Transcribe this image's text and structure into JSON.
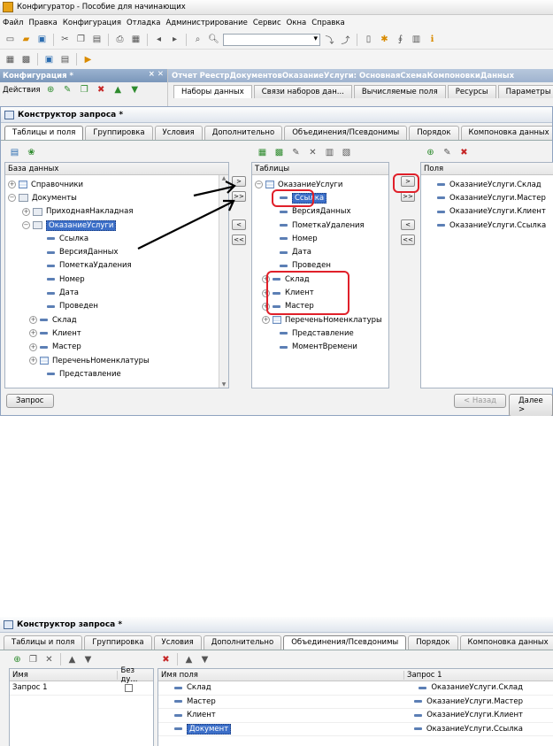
{
  "window": {
    "title": "Конфигуратор - Пособие для начинающих"
  },
  "menu": [
    "Файл",
    "Правка",
    "Конфигурация",
    "Отладка",
    "Администрирование",
    "Сервис",
    "Окна",
    "Справка"
  ],
  "config_panel": {
    "title": "Конфигурация *",
    "actions_label": "Действия"
  },
  "report_window": {
    "title": "Отчет РеестрДокументовОказаниеУслуги: ОсновнаяСхемаКомпоновкиДанных",
    "tabs": [
      "Наборы данных",
      "Связи наборов дан...",
      "Вычисляемые поля",
      "Ресурсы",
      "Параметры",
      "М"
    ]
  },
  "query_designer": {
    "title": "Конструктор запроса *",
    "tabs": [
      "Таблицы и поля",
      "Группировка",
      "Условия",
      "Дополнительно",
      "Объединения/Псевдонимы",
      "Порядок",
      "Компоновка данных",
      "Хар"
    ],
    "database_header": "База данных",
    "database_tree": [
      {
        "label": "Справочники",
        "level": 0,
        "expander": "+",
        "icon": "table"
      },
      {
        "label": "Документы",
        "level": 0,
        "expander": "−",
        "icon": "folder"
      },
      {
        "label": "ПриходнаяНакладная",
        "level": 1,
        "expander": "+",
        "icon": "folder"
      },
      {
        "label": "ОказаниеУслуги",
        "level": 1,
        "expander": "−",
        "icon": "folder",
        "selected": true
      },
      {
        "label": "Ссылка",
        "level": 2,
        "icon": "field"
      },
      {
        "label": "ВерсияДанных",
        "level": 2,
        "icon": "field"
      },
      {
        "label": "ПометкаУдаления",
        "level": 2,
        "icon": "field"
      },
      {
        "label": "Номер",
        "level": 2,
        "icon": "field"
      },
      {
        "label": "Дата",
        "level": 2,
        "icon": "field"
      },
      {
        "label": "Проведен",
        "level": 2,
        "icon": "field"
      },
      {
        "label": "Склад",
        "level": 1.5,
        "expander": "+",
        "icon": "field"
      },
      {
        "label": "Клиент",
        "level": 1.5,
        "expander": "+",
        "icon": "field"
      },
      {
        "label": "Мастер",
        "level": 1.5,
        "expander": "+",
        "icon": "field"
      },
      {
        "label": "ПереченьНоменклатуры",
        "level": 1.5,
        "expander": "+",
        "icon": "table"
      },
      {
        "label": "Представление",
        "level": 2,
        "icon": "field"
      }
    ],
    "tables_header": "Таблицы",
    "tables_tree": [
      {
        "label": "ОказаниеУслуги",
        "level": 0,
        "expander": "−",
        "icon": "table"
      },
      {
        "label": "Ссылка",
        "level": 1,
        "icon": "field",
        "selected": true
      },
      {
        "label": "ВерсияДанных",
        "level": 1,
        "icon": "field"
      },
      {
        "label": "ПометкаУдаления",
        "level": 1,
        "icon": "field"
      },
      {
        "label": "Номер",
        "level": 1,
        "icon": "field"
      },
      {
        "label": "Дата",
        "level": 1,
        "icon": "field"
      },
      {
        "label": "Проведен",
        "level": 1,
        "icon": "field"
      },
      {
        "label": "Склад",
        "level": 0.5,
        "expander": "+",
        "icon": "field"
      },
      {
        "label": "Клиент",
        "level": 0.5,
        "expander": "+",
        "icon": "field"
      },
      {
        "label": "Мастер",
        "level": 0.5,
        "expander": "+",
        "icon": "field"
      },
      {
        "label": "ПереченьНоменклатуры",
        "level": 0.5,
        "expander": "+",
        "icon": "table"
      },
      {
        "label": "Представление",
        "level": 1,
        "icon": "field"
      },
      {
        "label": "МоментВремени",
        "level": 1,
        "icon": "field"
      }
    ],
    "fields_header": "Поля",
    "fields": [
      "ОказаниеУслуги.Склад",
      "ОказаниеУслуги.Мастер",
      "ОказаниеУслуги.Клиент",
      "ОказаниеУслуги.Ссылка"
    ],
    "buttons": {
      "move_one": ">",
      "move_all": ">>",
      "remove_one": "<",
      "remove_all": "<<"
    },
    "footer": {
      "query": "Запрос",
      "back": "< Назад",
      "next": "Далее >"
    }
  },
  "unions_designer": {
    "title": "Конструктор запроса *",
    "tabs": [
      "Таблицы и поля",
      "Группировка",
      "Условия",
      "Дополнительно",
      "Объединения/Псевдонимы",
      "Порядок",
      "Компоновка данных",
      "Характеристики"
    ],
    "queries_columns": [
      "Имя",
      "Без ду..."
    ],
    "queries": [
      {
        "name": "Запрос 1"
      }
    ],
    "aliases_columns": [
      "Имя поля",
      "Запрос 1"
    ],
    "aliases": [
      {
        "alias": "Склад",
        "source": "ОказаниеУслуги.Склад"
      },
      {
        "alias": "Мастер",
        "source": "ОказаниеУслуги.Мастер"
      },
      {
        "alias": "Клиент",
        "source": "ОказаниеУслуги.Клиент"
      },
      {
        "alias": "Документ",
        "source": "ОказаниеУслуги.Ссылка",
        "selected": true
      }
    ]
  }
}
